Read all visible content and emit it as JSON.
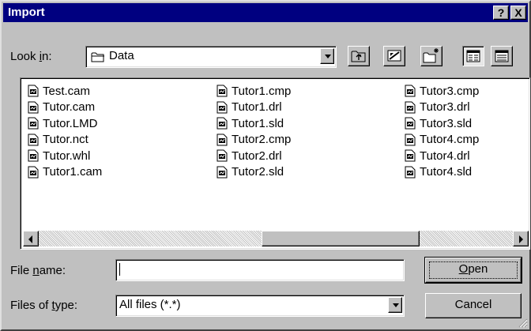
{
  "window": {
    "title": "Import",
    "help_label": "?",
    "close_label": "X"
  },
  "look_in": {
    "label_prefix": "Look ",
    "label_accel": "i",
    "label_suffix": "n:",
    "value": "Data"
  },
  "toolbar": {
    "icons": [
      "up-one-level-icon",
      "desktop-icon",
      "new-folder-icon",
      "list-view-icon",
      "details-view-icon"
    ]
  },
  "files": {
    "column1": [
      "Test.cam",
      "Tutor.cam",
      "Tutor.LMD",
      "Tutor.nct",
      "Tutor.whl",
      "Tutor1.cam"
    ],
    "column2": [
      "Tutor1.cmp",
      "Tutor1.drl",
      "Tutor1.sld",
      "Tutor2.cmp",
      "Tutor2.drl",
      "Tutor2.sld"
    ],
    "column3": [
      "Tutor3.cmp",
      "Tutor3.drl",
      "Tutor3.sld",
      "Tutor4.cmp",
      "Tutor4.drl",
      "Tutor4.sld"
    ]
  },
  "file_name": {
    "label_prefix": "File ",
    "label_accel": "n",
    "label_suffix": "ame:",
    "value": ""
  },
  "file_type": {
    "label_prefix": "Files of ",
    "label_accel": "t",
    "label_suffix": "ype:",
    "value": "All files (*.*)"
  },
  "buttons": {
    "open_accel": "O",
    "open_rest": "pen",
    "cancel": "Cancel"
  },
  "colors": {
    "face": "#c0c0c0",
    "titlebar": "#000080",
    "window": "#ffffff"
  }
}
